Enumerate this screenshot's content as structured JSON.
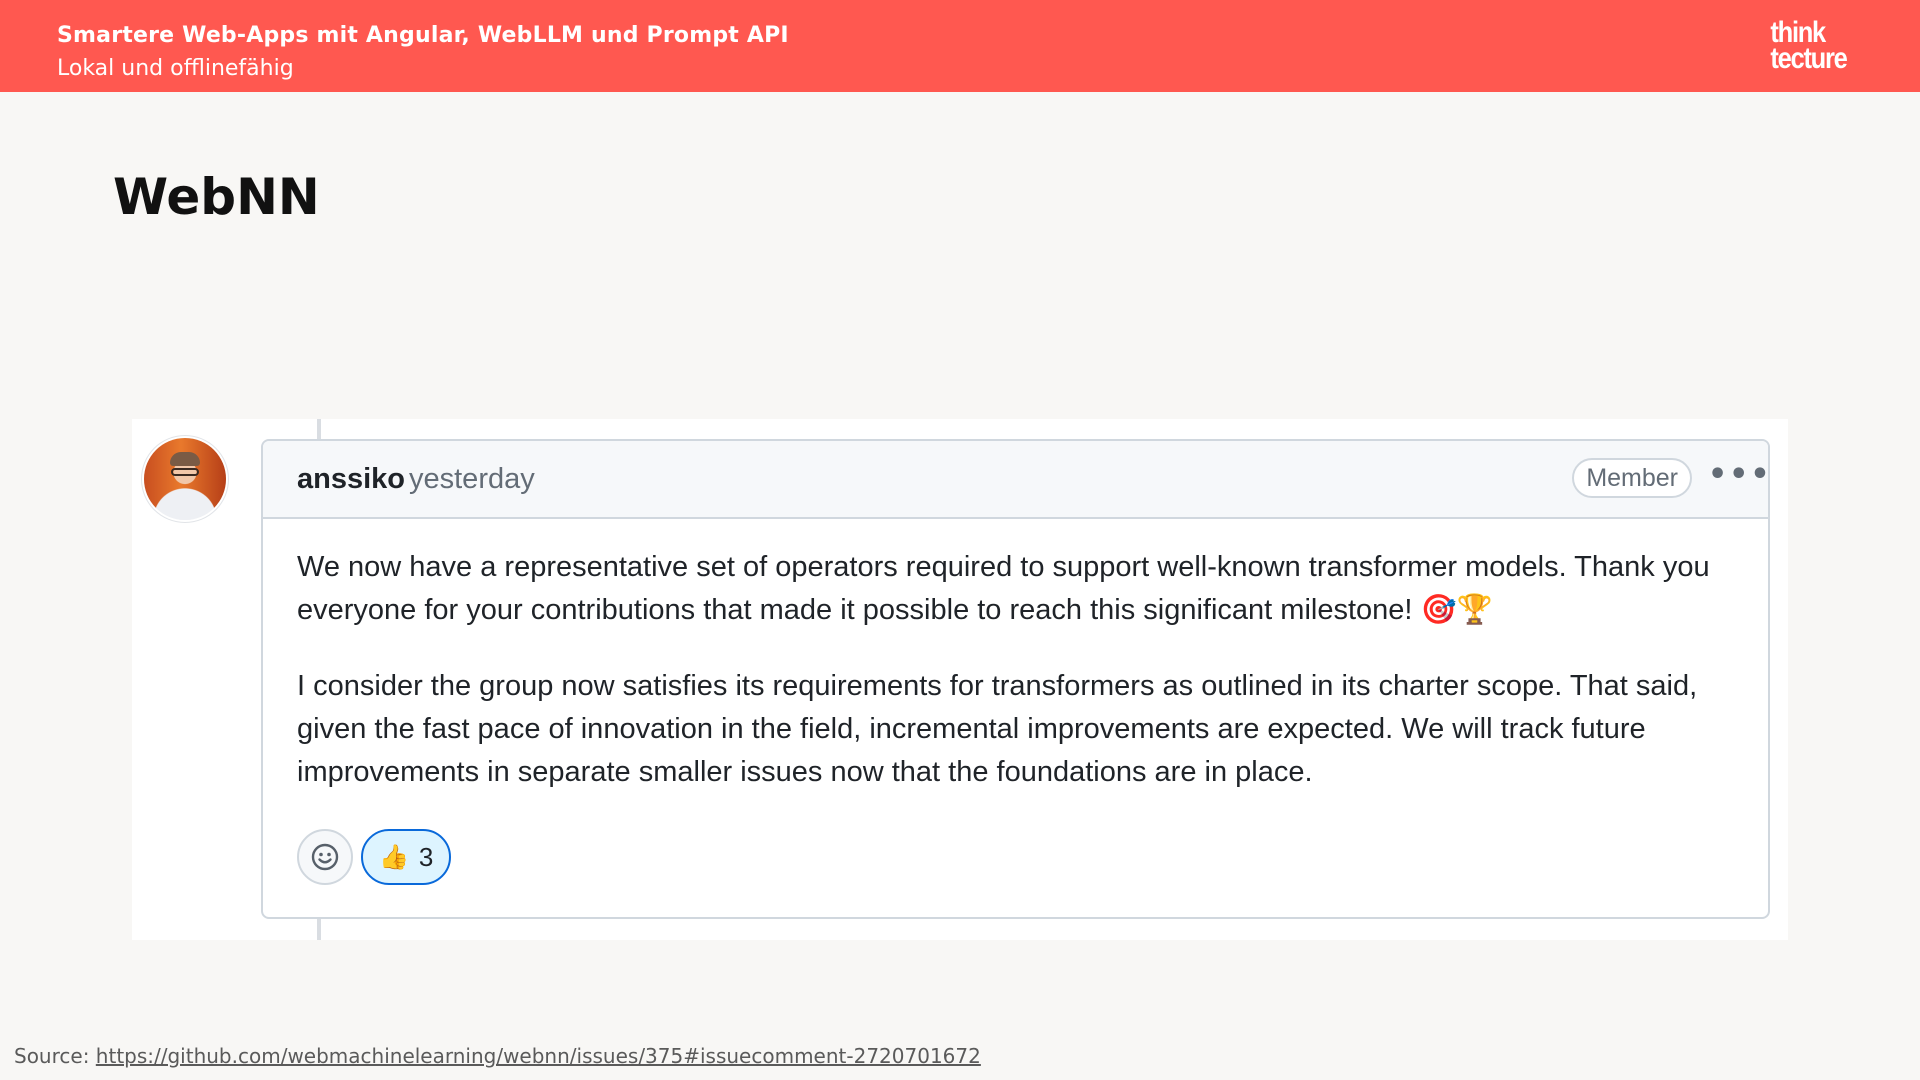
{
  "header": {
    "title": "Smartere Web-Apps mit Angular, WebLLM und Prompt API",
    "subtitle": "Lokal und offlinefähig",
    "brand_line1": "think",
    "brand_line2": "tecture",
    "background_color": "#ff5850"
  },
  "slide": {
    "title": "WebNN"
  },
  "comment": {
    "author": "anssiko",
    "timestamp": "yesterday",
    "badge": "Member",
    "more_icon": "kebab-horizontal-icon",
    "paragraph1": "We now have a representative set of operators required to support well-known transformer models. Thank you everyone for your contributions that made it possible to reach this significant milestone! 🎯🏆",
    "paragraph2": "I consider the group now satisfies its requirements for transformers as outlined in its charter scope. That said, given the fast pace of innovation in the field, incremental improvements are expected. We will track future improvements in separate smaller issues now that the foundations are in place.",
    "reactions": {
      "add_icon": "smiley-icon",
      "thumbs_up_emoji": "👍",
      "thumbs_up_count": "3"
    }
  },
  "footer": {
    "source_label": "Source:",
    "source_url": "https://github.com/webmachinelearning/webnn/issues/375#issuecomment-2720701672"
  }
}
